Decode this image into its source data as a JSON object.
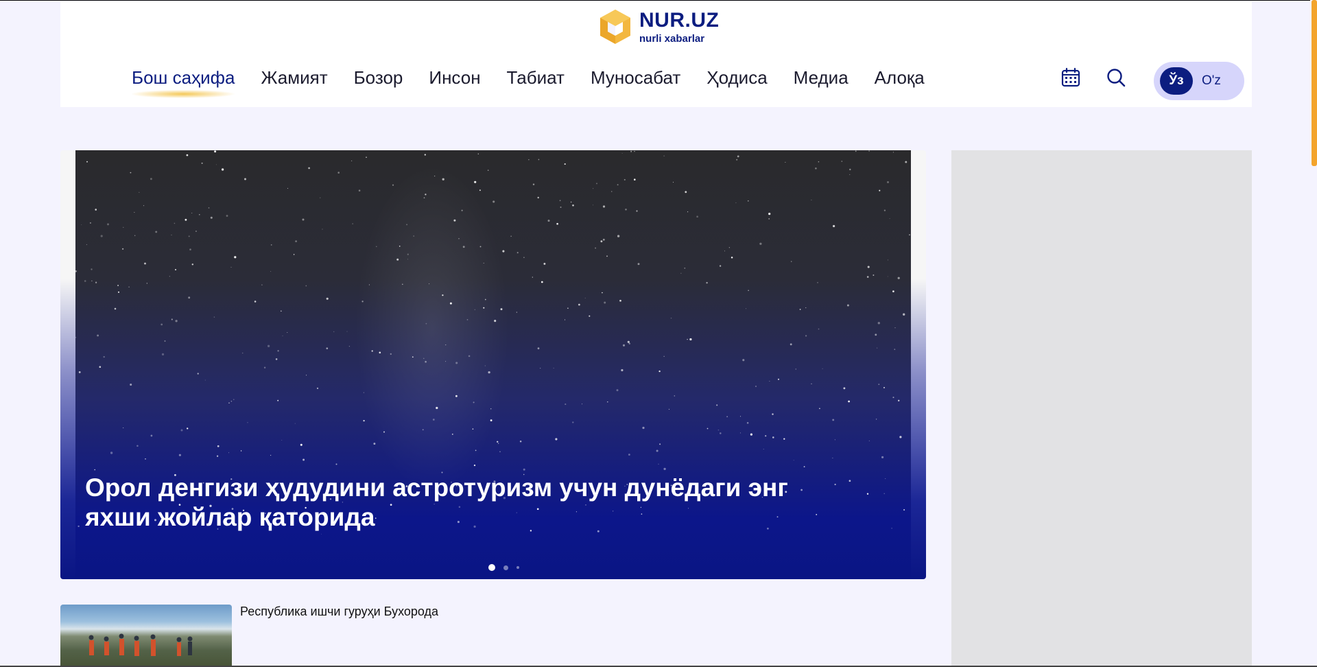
{
  "brand": {
    "name": "NUR.UZ",
    "tagline": "nurli xabarlar",
    "accent_color": "#0c1d80",
    "logo_color": "#f3b73f"
  },
  "nav": {
    "items": [
      {
        "label": "Бош саҳифа",
        "active": true
      },
      {
        "label": "Жамият"
      },
      {
        "label": "Бозор"
      },
      {
        "label": "Инсон"
      },
      {
        "label": "Табиат"
      },
      {
        "label": "Муносабат"
      },
      {
        "label": "Ҳодиса"
      },
      {
        "label": "Медиа"
      },
      {
        "label": "Алоқа"
      }
    ]
  },
  "tools": {
    "calendar_icon": "calendar-icon",
    "search_icon": "search-icon"
  },
  "language": {
    "active": "Ўз",
    "other": "O'z"
  },
  "hero": {
    "title": "Орол денгизи ҳудудини астротуризм учун дунёдаги энг яхши жойлар қаторида",
    "slides_total": 3,
    "active_slide": 1
  },
  "news": [
    {
      "title": "Республика ишчи гуруҳи Бухорода"
    }
  ],
  "colors": {
    "page_bg": "#f4f3fe",
    "hero_overlay": "#0a1584",
    "scrollbar_thumb": "#f3a42c",
    "sidebar_bg": "#e2e2e4"
  }
}
